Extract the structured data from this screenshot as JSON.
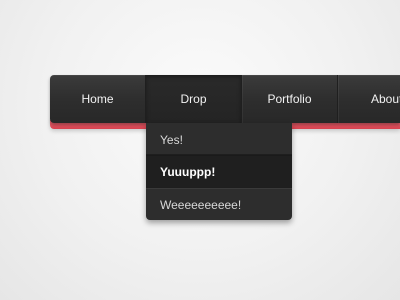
{
  "nav": {
    "items": [
      {
        "label": "Home"
      },
      {
        "label": "Drop"
      },
      {
        "label": "Portfolio"
      },
      {
        "label": "About"
      }
    ],
    "active_index": 1
  },
  "dropdown": {
    "items": [
      {
        "label": "Yes!"
      },
      {
        "label": "Yuuuppp!"
      },
      {
        "label": "Weeeeeeeeee!"
      }
    ],
    "highlighted_index": 1
  },
  "colors": {
    "bar": "#2e2e2e",
    "accent": "#e34b58",
    "dropdown": "#2d2d2d",
    "text": "#f2f2f2"
  }
}
